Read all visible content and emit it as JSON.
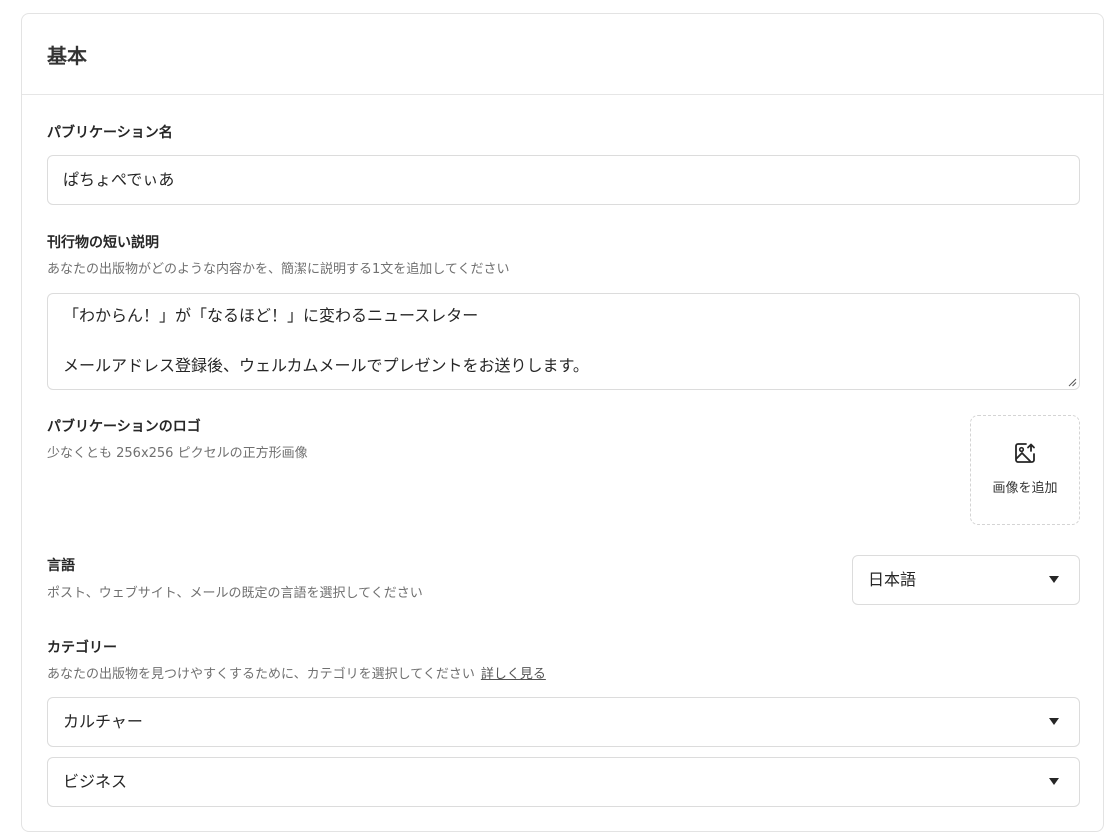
{
  "section": {
    "title": "基本"
  },
  "publication_name": {
    "label": "パブリケーション名",
    "value": "ぱちょぺでぃあ"
  },
  "short_description": {
    "label": "刊行物の短い説明",
    "help": "あなたの出版物がどのような内容かを、簡潔に説明する1文を追加してください",
    "lines": [
      "「わからん！」が「なるほど！」に変わるニュースレター",
      "",
      "メールアドレス登録後、ウェルカムメールでプレゼントをお送りします。"
    ]
  },
  "logo": {
    "label": "パブリケーションのロゴ",
    "help": "少なくとも 256x256 ピクセルの正方形画像",
    "button_label": "画像を追加",
    "icon": "image-upload-icon"
  },
  "language": {
    "label": "言語",
    "help": "ポスト、ウェブサイト、メールの既定の言語を選択してください",
    "selected": "日本語"
  },
  "category": {
    "label": "カテゴリー",
    "help": "あなたの出版物を見つけやすくするために、カテゴリを選択してください",
    "learn_more": "詳しく見る",
    "primary": "カルチャー",
    "secondary": "ビジネス"
  }
}
